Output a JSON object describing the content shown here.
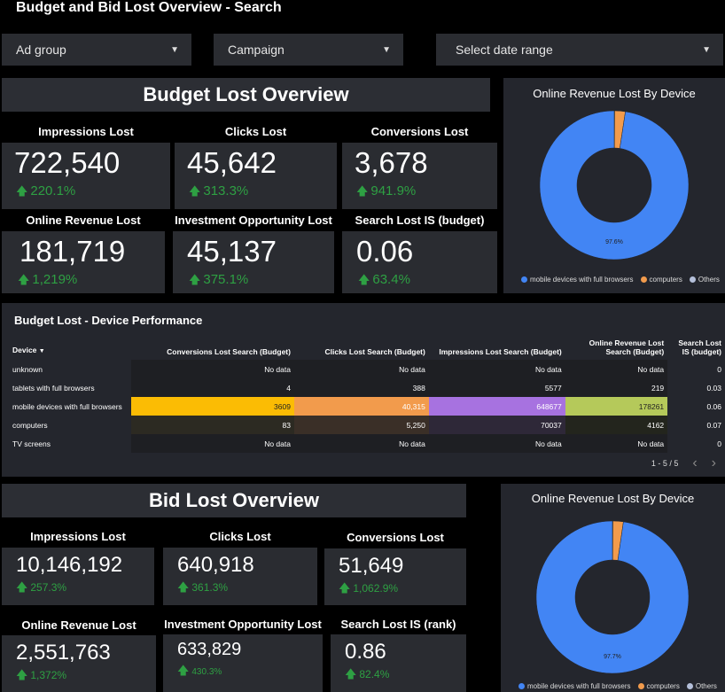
{
  "header": {
    "title": "Budget and Bid Lost Overview - Search"
  },
  "filters": [
    {
      "label": "Ad group"
    },
    {
      "label": "Campaign"
    },
    {
      "label": "Select date range"
    }
  ],
  "budget": {
    "title": "Budget Lost Overview",
    "kpis": [
      {
        "label": "Impressions Lost",
        "value": "722,540",
        "delta": "220.1%"
      },
      {
        "label": "Clicks Lost",
        "value": "45,642",
        "delta": "313.3%"
      },
      {
        "label": "Conversions Lost",
        "value": "3,678",
        "delta": "941.9%"
      },
      {
        "label": "Online Revenue Lost",
        "value": "181,719",
        "delta": "1,219%"
      },
      {
        "label": "Investment Opportunity Lost",
        "value": "45,137",
        "delta": "375.1%"
      },
      {
        "label": "Search Lost IS (budget)",
        "value": "0.06",
        "delta": "63.4%"
      }
    ],
    "donut": {
      "title": "Online Revenue Lost By Device",
      "center_label": "97.6%",
      "slices": [
        {
          "name": "mobile devices with full browsers",
          "pct": 97.6,
          "color": "#4285f4"
        },
        {
          "name": "computers",
          "pct": 2.3,
          "color": "#f29b4c"
        },
        {
          "name": "Others",
          "pct": 0.1,
          "color": "#b4bfd9"
        }
      ],
      "legend": [
        "mobile devices with full browsers",
        "computers",
        "Others"
      ]
    }
  },
  "table": {
    "title": "Budget Lost - Device Performance",
    "headers": [
      "Device",
      "Conversions Lost Search (Budget)",
      "Clicks Lost Search (Budget)",
      "Impressions Lost Search (Budget)",
      "Online Revenue Lost Search (Budget)",
      "Search Lost IS (budget)"
    ],
    "rows": [
      [
        "unknown",
        "No data",
        "No data",
        "No data",
        "No data",
        "0"
      ],
      [
        "tablets with full browsers",
        "4",
        "388",
        "5577",
        "219",
        "0.03"
      ],
      [
        "mobile devices with full browsers",
        "3609",
        "40,315",
        "648677",
        "178261",
        "0.06"
      ],
      [
        "computers",
        "83",
        "5,250",
        "70037",
        "4162",
        "0.07"
      ],
      [
        "TV screens",
        "No data",
        "No data",
        "No data",
        "No data",
        "0"
      ]
    ],
    "pager": "1 - 5 / 5"
  },
  "bid": {
    "title": "Bid Lost Overview",
    "kpis": [
      {
        "label": "Impressions Lost",
        "value": "10,146,192",
        "delta": "257.3%"
      },
      {
        "label": "Clicks Lost",
        "value": "640,918",
        "delta": "361.3%"
      },
      {
        "label": "Conversions Lost",
        "value": "51,649",
        "delta": "1,062.9%"
      },
      {
        "label": "Online Revenue Lost",
        "value": "2,551,763",
        "delta": "1,372%"
      },
      {
        "label": "Investment Opportunity Lost",
        "value": "633,829",
        "delta": "430.3%"
      },
      {
        "label": "Search Lost IS (rank)",
        "value": "0.86",
        "delta": "82.4%"
      }
    ],
    "donut": {
      "title": "Online Revenue Lost By Device",
      "center_label": "97.7%",
      "slices": [
        {
          "name": "mobile devices with full browsers",
          "pct": 97.7,
          "color": "#4285f4"
        },
        {
          "name": "computers",
          "pct": 2.2,
          "color": "#f29b4c"
        },
        {
          "name": "Others",
          "pct": 0.1,
          "color": "#b4bfd9"
        }
      ],
      "legend": [
        "mobile devices with full browsers",
        "computers",
        "Others"
      ]
    }
  },
  "colors": {
    "accent_green": "#2ea043",
    "mobile": "#4285f4",
    "computers": "#f29b4c",
    "others": "#b4bfd9"
  }
}
